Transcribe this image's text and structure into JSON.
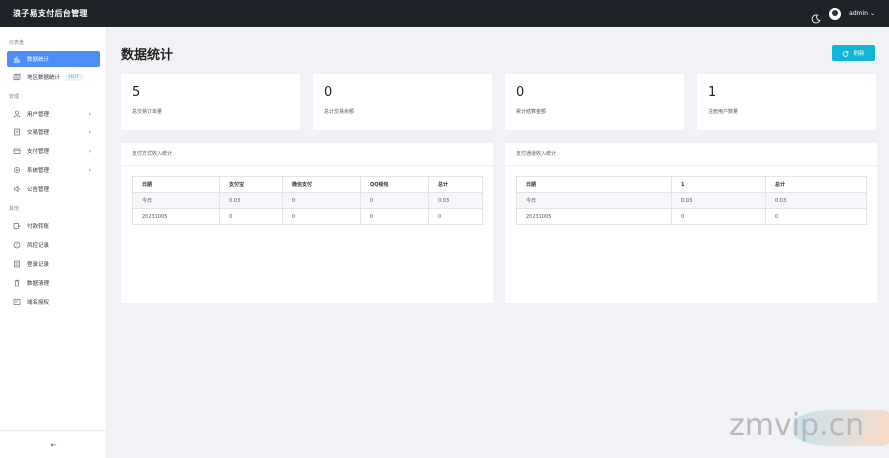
{
  "header": {
    "title": "浪子易支付后台管理",
    "user": "admin",
    "dropdown_glyph": "⌄"
  },
  "sidebar": {
    "groups": [
      {
        "title": "仪表盘"
      },
      {
        "title": "管理"
      },
      {
        "title": "其他"
      }
    ],
    "items": [
      {
        "label": "数据统计",
        "icon": "bar-chart-icon"
      },
      {
        "label": "地区数据统计",
        "icon": "map-icon",
        "badge": "HOT"
      },
      {
        "label": "用户管理",
        "icon": "user-icon",
        "arrow": "›"
      },
      {
        "label": "交易管理",
        "icon": "document-icon",
        "arrow": "›"
      },
      {
        "label": "支付管理",
        "icon": "wallet-icon",
        "arrow": "›"
      },
      {
        "label": "系统管理",
        "icon": "gear-icon",
        "arrow": "›"
      },
      {
        "label": "公告管理",
        "icon": "speaker-icon"
      },
      {
        "label": "付款转账",
        "icon": "transfer-icon"
      },
      {
        "label": "风控记录",
        "icon": "alert-icon"
      },
      {
        "label": "登录记录",
        "icon": "list-icon"
      },
      {
        "label": "数据清理",
        "icon": "trash-icon"
      },
      {
        "label": "域名授权",
        "icon": "certificate-icon"
      }
    ],
    "footer_glyph": "⇤"
  },
  "main": {
    "title": "数据统计",
    "refresh_label": "刷新",
    "stats": [
      {
        "value": "5",
        "label": "总交易订单量"
      },
      {
        "value": "0",
        "label": "总计交易余额"
      },
      {
        "value": "0",
        "label": "累计结算金额"
      },
      {
        "value": "1",
        "label": "注册用户数量"
      }
    ],
    "panels": [
      {
        "title": "支付方式收入统计",
        "headers": [
          "日期",
          "支付宝",
          "微信支付",
          "QQ钱包",
          "总计"
        ],
        "rows": [
          [
            "今日",
            "0.03",
            "0",
            "0",
            "0.03"
          ],
          [
            "20231005",
            "0",
            "0",
            "0",
            "0"
          ]
        ]
      },
      {
        "title": "支付通道收入统计",
        "headers": [
          "日期",
          "1",
          "总计"
        ],
        "rows": [
          [
            "今日",
            "0.03",
            "0.03"
          ],
          [
            "20231005",
            "0",
            "0"
          ]
        ]
      }
    ]
  },
  "watermark": "zmvip.cn",
  "colors": {
    "topbar": "#1f2329",
    "active": "#4e8df5",
    "refresh": "#12b5d6"
  }
}
